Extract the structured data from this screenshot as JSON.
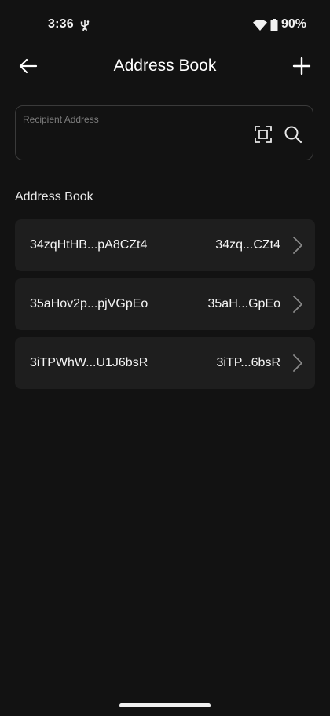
{
  "status_bar": {
    "time": "3:36",
    "battery": "90%",
    "icons": [
      "usb-icon",
      "wifi-icon",
      "battery-icon"
    ]
  },
  "app_bar": {
    "title": "Address Book",
    "back_icon": "arrow-left-icon",
    "add_icon": "plus-icon"
  },
  "recipient": {
    "label": "Recipient Address",
    "value": "",
    "scan_icon": "scan-icon",
    "search_icon": "search-icon"
  },
  "section": {
    "title": "Address Book"
  },
  "addresses": [
    {
      "name": "34zqHtHB...pA8CZt4",
      "short": "34zq...CZt4"
    },
    {
      "name": "35aHov2p...pjVGpEo",
      "short": "35aH...GpEo"
    },
    {
      "name": "3iTPWhW...U1J6bsR",
      "short": "3iTP...6bsR"
    }
  ],
  "colors": {
    "background": "#121212",
    "card": "#1e1e1e",
    "border": "#3a3a3a",
    "label": "#7d7d7d"
  }
}
